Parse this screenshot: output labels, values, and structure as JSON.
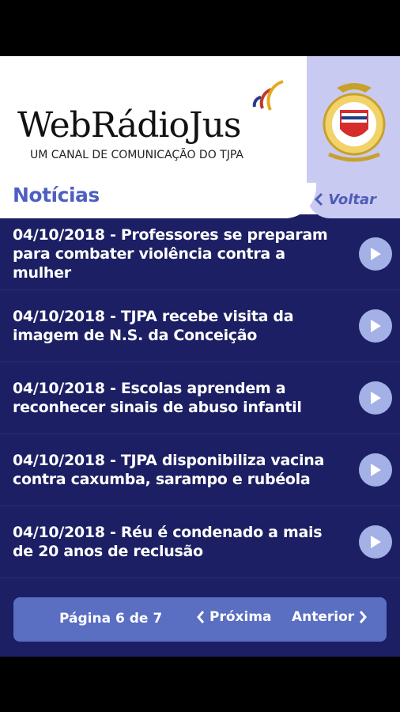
{
  "header": {
    "logo_text": "WebRádioJus",
    "logo_subtitle": "UM CANAL DE COMUNICAÇÃO DO TJPA",
    "crest_icon": "tjpa-coat-of-arms-icon"
  },
  "page_title": "Notícias",
  "back_button": {
    "label": "Voltar"
  },
  "news": [
    {
      "title": "04/10/2018 - Professores se preparam para combater violência contra a mulher"
    },
    {
      "title": "04/10/2018 - TJPA recebe visita da imagem de N.S. da Conceição"
    },
    {
      "title": "04/10/2018 - Escolas aprendem a reconhecer sinais de abuso infantil"
    },
    {
      "title": "04/10/2018 - TJPA disponibiliza vacina contra caxumba, sarampo e rubéola"
    },
    {
      "title": "04/10/2018 - Réu é condenado a mais de 20 anos de reclusão"
    }
  ],
  "pager": {
    "page_info": "Página 6 de 7",
    "next_label": "Próxima",
    "prev_label": "Anterior"
  },
  "colors": {
    "background": "#1c1f63",
    "accent": "#4f5fc0",
    "pager": "#5a6ec2",
    "play_button": "#a4b1e6"
  }
}
